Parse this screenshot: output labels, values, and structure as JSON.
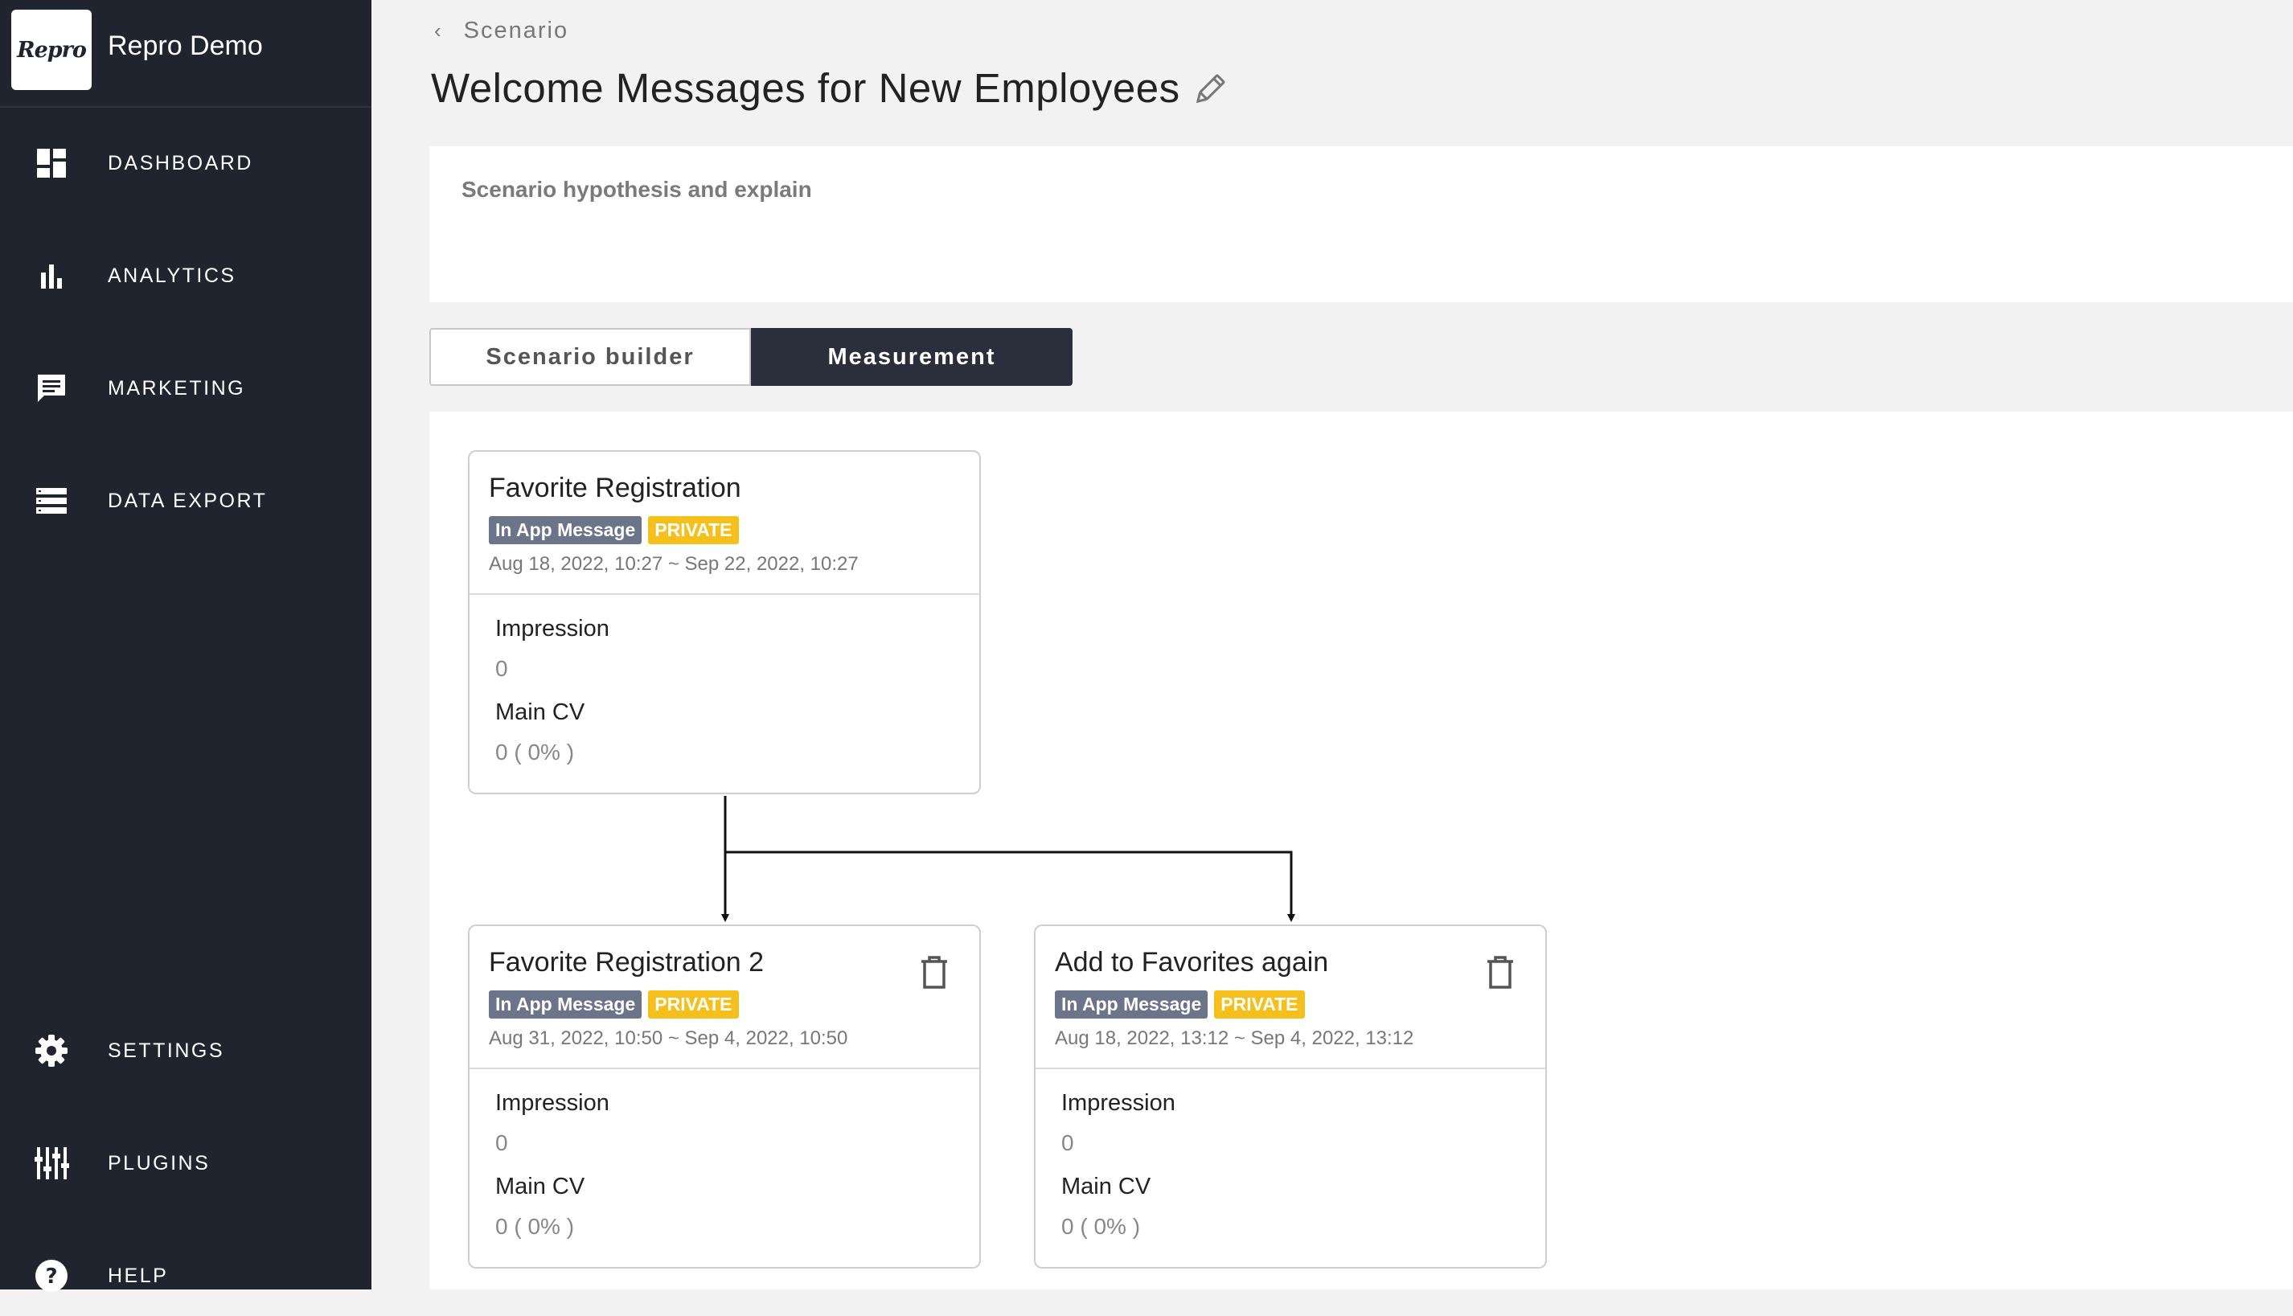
{
  "app": {
    "logo_text": "Repro",
    "name": "Repro Demo"
  },
  "nav": {
    "top": [
      {
        "label": "DASHBOARD",
        "icon": "dashboard-icon"
      },
      {
        "label": "ANALYTICS",
        "icon": "bar-chart-icon"
      },
      {
        "label": "MARKETING",
        "icon": "message-icon"
      },
      {
        "label": "DATA EXPORT",
        "icon": "storage-icon"
      }
    ],
    "bottom": [
      {
        "label": "SETTINGS",
        "icon": "gear-icon"
      },
      {
        "label": "PLUGINS",
        "icon": "plugins-icon"
      },
      {
        "label": "HELP",
        "icon": "help-icon"
      }
    ]
  },
  "breadcrumb": {
    "label": "Scenario"
  },
  "page": {
    "title": "Welcome Messages for New Employees"
  },
  "hypothesis": {
    "label": "Scenario hypothesis and explain"
  },
  "tabs": [
    {
      "label": "Scenario builder",
      "active": false
    },
    {
      "label": "Measurement",
      "active": true
    }
  ],
  "cards": [
    {
      "title": "Favorite Registration",
      "type_badge": "In App Message",
      "status_badge": "PRIVATE",
      "date_range": "Aug 18, 2022, 10:27 ~ Sep 22, 2022, 10:27",
      "impression_label": "Impression",
      "impression_value": "0",
      "cv_label": "Main CV",
      "cv_value": "0 ( 0% )",
      "deletable": false
    },
    {
      "title": "Favorite Registration 2",
      "type_badge": "In App Message",
      "status_badge": "PRIVATE",
      "date_range": "Aug 31, 2022, 10:50 ~ Sep 4, 2022, 10:50",
      "impression_label": "Impression",
      "impression_value": "0",
      "cv_label": "Main CV",
      "cv_value": "0 ( 0% )",
      "deletable": true
    },
    {
      "title": "Add to Favorites again",
      "type_badge": "In App Message",
      "status_badge": "PRIVATE",
      "date_range": "Aug 18, 2022, 13:12 ~ Sep 4, 2022, 13:12",
      "impression_label": "Impression",
      "impression_value": "0",
      "cv_label": "Main CV",
      "cv_value": "0 ( 0% )",
      "deletable": true
    }
  ],
  "colors": {
    "sidebar_bg": "#20242f",
    "active_tab_bg": "#2b2f3b",
    "badge_in_app": "#6b7488",
    "badge_private": "#f5bf1c"
  }
}
